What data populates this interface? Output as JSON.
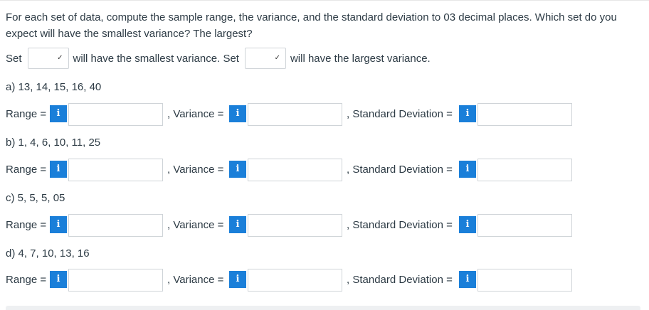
{
  "question": {
    "text": "For each set of data, compute the sample range, the variance, and the standard deviation to 03 decimal places. Which set do you expect will have the smallest variance? The largest?"
  },
  "set_row": {
    "prefix": "Set",
    "middle": "will have the smallest variance. Set",
    "suffix": "will have the largest variance.",
    "smallest_value": "",
    "largest_value": ""
  },
  "labels": {
    "range": "Range =",
    "variance": ", Variance =",
    "std": ", Standard Deviation =",
    "info_glyph": "i"
  },
  "sets": [
    {
      "label": "a) 13, 14, 15, 16, 40"
    },
    {
      "label": "b) 1, 4, 6, 10, 11, 25"
    },
    {
      "label": "c) 5, 5, 5, 05"
    },
    {
      "label": "d) 4, 7, 10, 13, 16"
    }
  ]
}
